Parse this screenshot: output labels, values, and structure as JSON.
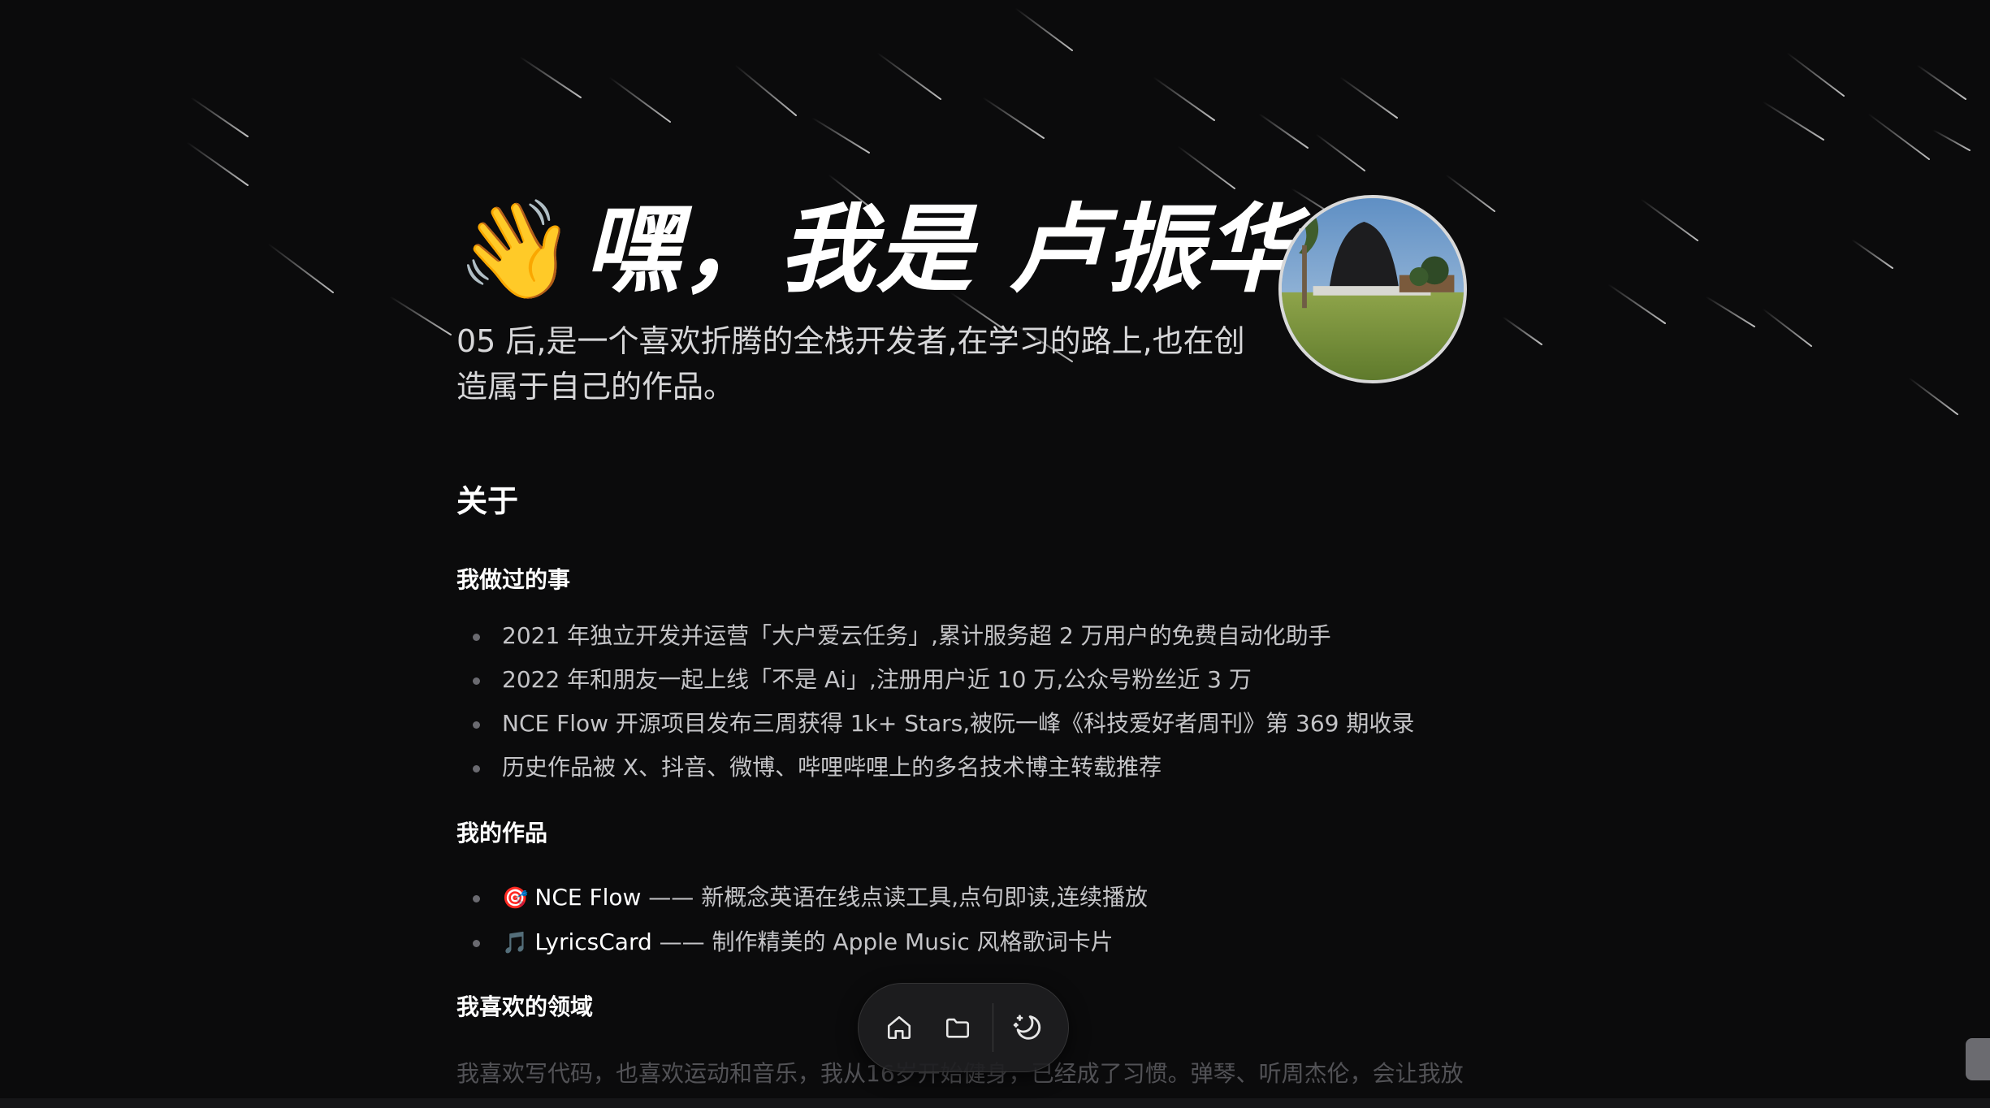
{
  "hero": {
    "wave_emoji": "👋",
    "title": "嘿，我是 卢振华",
    "subtitle": "05 后,是一个喜欢折腾的全栈开发者,在学习的路上,也在创造属于自己的作品。"
  },
  "about": {
    "title": "关于",
    "done_title": "我做过的事",
    "done_items": [
      "2021 年独立开发并运营「大户爱云任务」,累计服务超 2 万用户的免费自动化助手",
      "2022 年和朋友一起上线「不是 Ai」,注册用户近 10 万,公众号粉丝近 3 万",
      "NCE Flow 开源项目发布三周获得 1k+ Stars,被阮一峰《科技爱好者周刊》第 369 期收录",
      "历史作品被 X、抖音、微博、哔哩哔哩上的多名技术博主转载推荐"
    ],
    "works_title": "我的作品",
    "works": [
      {
        "icon": "🎯",
        "name": "NCE Flow",
        "desc": " —— 新概念英语在线点读工具,点句即读,连续播放"
      },
      {
        "icon": "🎵",
        "name": "LyricsCard",
        "desc": " —— 制作精美的 Apple Music 风格歌词卡片"
      }
    ],
    "likes_title": "我喜欢的领域",
    "likes_text": "我喜欢写代码，也喜欢运动和音乐，我从16岁开始健身，已经成了习惯。弹琴、听周杰伦，会让我放"
  },
  "dock": {
    "icons": [
      "home-icon",
      "folder-icon",
      "theme-toggle-icon"
    ]
  },
  "colors": {
    "background": "#0b0b0c",
    "text_primary": "#ffffff",
    "text_secondary": "#c4c4c7"
  }
}
